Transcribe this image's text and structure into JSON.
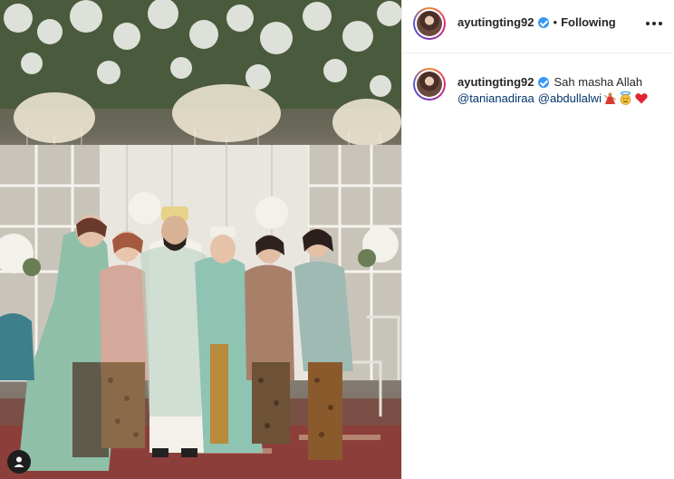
{
  "post": {
    "author": {
      "username": "ayutingting92",
      "verified": true
    },
    "header": {
      "separator": "•",
      "follow_status": "Following",
      "more_icon": "more-horizontal-icon"
    },
    "caption": {
      "username": "ayutingting92",
      "text": "Sah masha Allah",
      "mentions": [
        "@tanianadiraa",
        "@abdullalwi"
      ],
      "emojis": [
        "dancer-emoji",
        "smiling-face-with-halo-emoji",
        "red-heart-emoji"
      ]
    },
    "photo": {
      "tag_icon": "user-tag-icon"
    }
  },
  "colors": {
    "accent": "#3897f0",
    "mention": "#003569",
    "heart": "#ed4956",
    "text": "#262626",
    "divider": "#efefef"
  }
}
